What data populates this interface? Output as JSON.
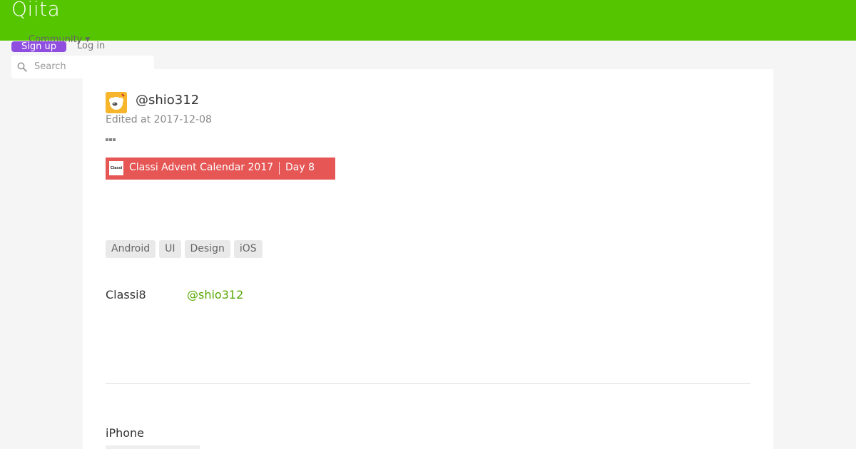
{
  "header": {
    "logo": "Qiita",
    "community_label": "Community",
    "signup_label": "Sign up",
    "login_label": "Log in",
    "search_placeholder": "Search",
    "brand_color": "#55c500",
    "signup_color": "#8f4ee0"
  },
  "article": {
    "username": "@shio312",
    "edited": "Edited at 2017-12-08",
    "advent": {
      "title": "Classi Advent Calendar 2017",
      "day": "Day 8",
      "logo_text": "Classi",
      "color": "#e55655"
    },
    "tags": [
      "Android",
      "UI",
      "Design",
      "iOS"
    ],
    "organization": "Classi8",
    "author_link": "@shio312",
    "section_heading": "iPhone"
  },
  "icons": {
    "search": "search-icon",
    "caret": "chevron-down-icon",
    "more": "more-icon"
  }
}
